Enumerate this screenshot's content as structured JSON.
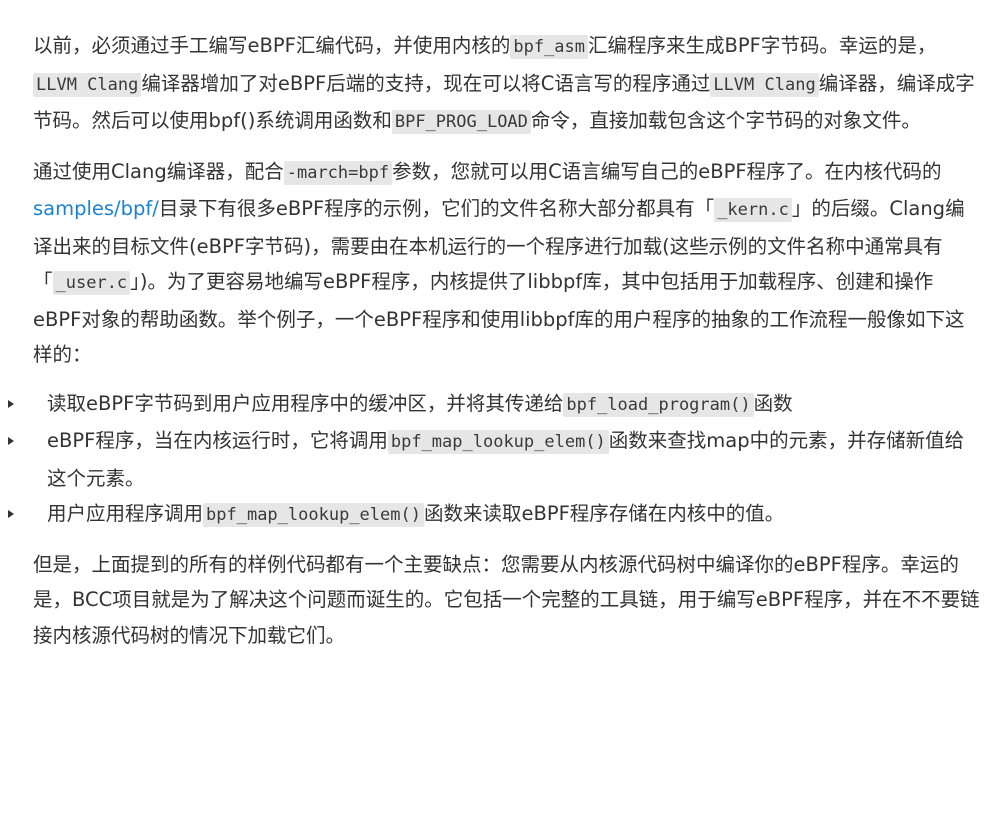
{
  "para1": {
    "t1": "以前，必须通过手工编写eBPF汇编代码，并使用内核的",
    "c1": "bpf_asm",
    "t2": "汇编程序来生成BPF字节码。幸运的是，",
    "c2": "LLVM Clang",
    "t3": "编译器增加了对eBPF后端的支持，现在可以将C语言写的程序通过",
    "c3": "LLVM Clang",
    "t4": "编译器，编译成字节码。然后可以使用bpf()系统调用函数和",
    "c4": "BPF_PROG_LOAD",
    "t5": "命令，直接加载包含这个字节码的对象文件。"
  },
  "para2": {
    "t1": "通过使用Clang编译器，配合",
    "c1": "-march=bpf",
    "t2": "参数，您就可以用C语言编写自己的eBPF程序了。在内核代码的",
    "link": "samples/bpf/",
    "t3": "目录下有很多eBPF程序的示例，它们的文件名称大部分都具有「",
    "c2": "_kern.c",
    "t4": "」的后缀。Clang编译出来的目标文件(eBPF字节码)，需要由在本机运行的一个程序进行加载(这些示例的文件名称中通常具有「",
    "c3": "_user.c",
    "t5": "」)。为了更容易地编写eBPF程序，内核提供了libbpf库，其中包括用于加载程序、创建和操作eBPF对象的帮助函数。举个例子，一个eBPF程序和使用libbpf库的用户程序的抽象的工作流程一般像如下这样的："
  },
  "bullets": [
    {
      "t1": "读取eBPF字节码到用户应用程序中的缓冲区，并将其传递给",
      "c1": "bpf_load_program()",
      "t2": "函数"
    },
    {
      "t1": "eBPF程序，当在内核运行时，它将调用",
      "c1": "bpf_map_lookup_elem()",
      "t2": "函数来查找map中的元素，并存储新值给这个元素。"
    },
    {
      "t1": "用户应用程序调用",
      "c1": "bpf_map_lookup_elem()",
      "t2": "函数来读取eBPF程序存储在内核中的值。"
    }
  ],
  "para3": {
    "t1": "但是，上面提到的所有的样例代码都有一个主要缺点：您需要从内核源代码树中编译你的eBPF程序。幸运的是，BCC项目就是为了解决这个问题而诞生的。它包括一个完整的工具链，用于编写eBPF程序，并在不不要链接内核源代码树的情况下加载它们。"
  }
}
